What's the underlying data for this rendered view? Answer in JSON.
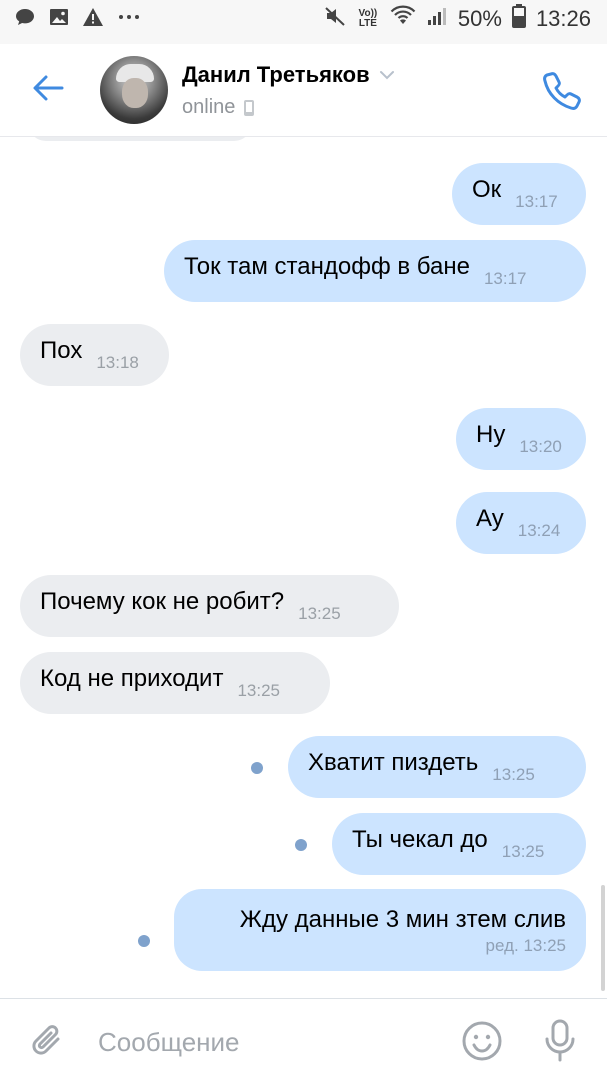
{
  "status_bar": {
    "battery": "50%",
    "time": "13:26",
    "network_label": "Vo)) LTE",
    "icons": [
      "chat-bubble-icon",
      "image-icon",
      "warning-icon",
      "more-icon",
      "mute-icon",
      "wifi-icon",
      "signal-icon",
      "battery-icon"
    ]
  },
  "header": {
    "name": "Данил Третьяков",
    "status": "online",
    "accent_color": "#3f8ae0"
  },
  "messages": [
    {
      "dir": "out",
      "text": "Ок",
      "time": "13:17"
    },
    {
      "dir": "out",
      "text": "Ток там стандофф в бане",
      "time": "13:17"
    },
    {
      "dir": "in",
      "text": "Пох",
      "time": "13:18"
    },
    {
      "dir": "out",
      "text": "Ну",
      "time": "13:20"
    },
    {
      "dir": "out",
      "text": "Ау",
      "time": "13:24"
    },
    {
      "dir": "in",
      "text": "Почему кок не робит?",
      "time": "13:25"
    },
    {
      "dir": "in",
      "text": "Код не приходит",
      "time": "13:25"
    },
    {
      "dir": "out",
      "text": "Хватит пиздеть",
      "time": "13:25",
      "unread": true
    },
    {
      "dir": "out",
      "text": "Ты чекал до",
      "time": "13:25",
      "unread": true
    },
    {
      "dir": "out",
      "text": "Жду данные 3 мин зтем слив",
      "time": "ред. 13:25",
      "unread": true
    }
  ],
  "composer": {
    "placeholder": "Сообщение"
  },
  "colors": {
    "outgoing_bubble": "#cce4ff",
    "incoming_bubble": "#ebedf0",
    "unread_dot": "#7fa2cc"
  }
}
